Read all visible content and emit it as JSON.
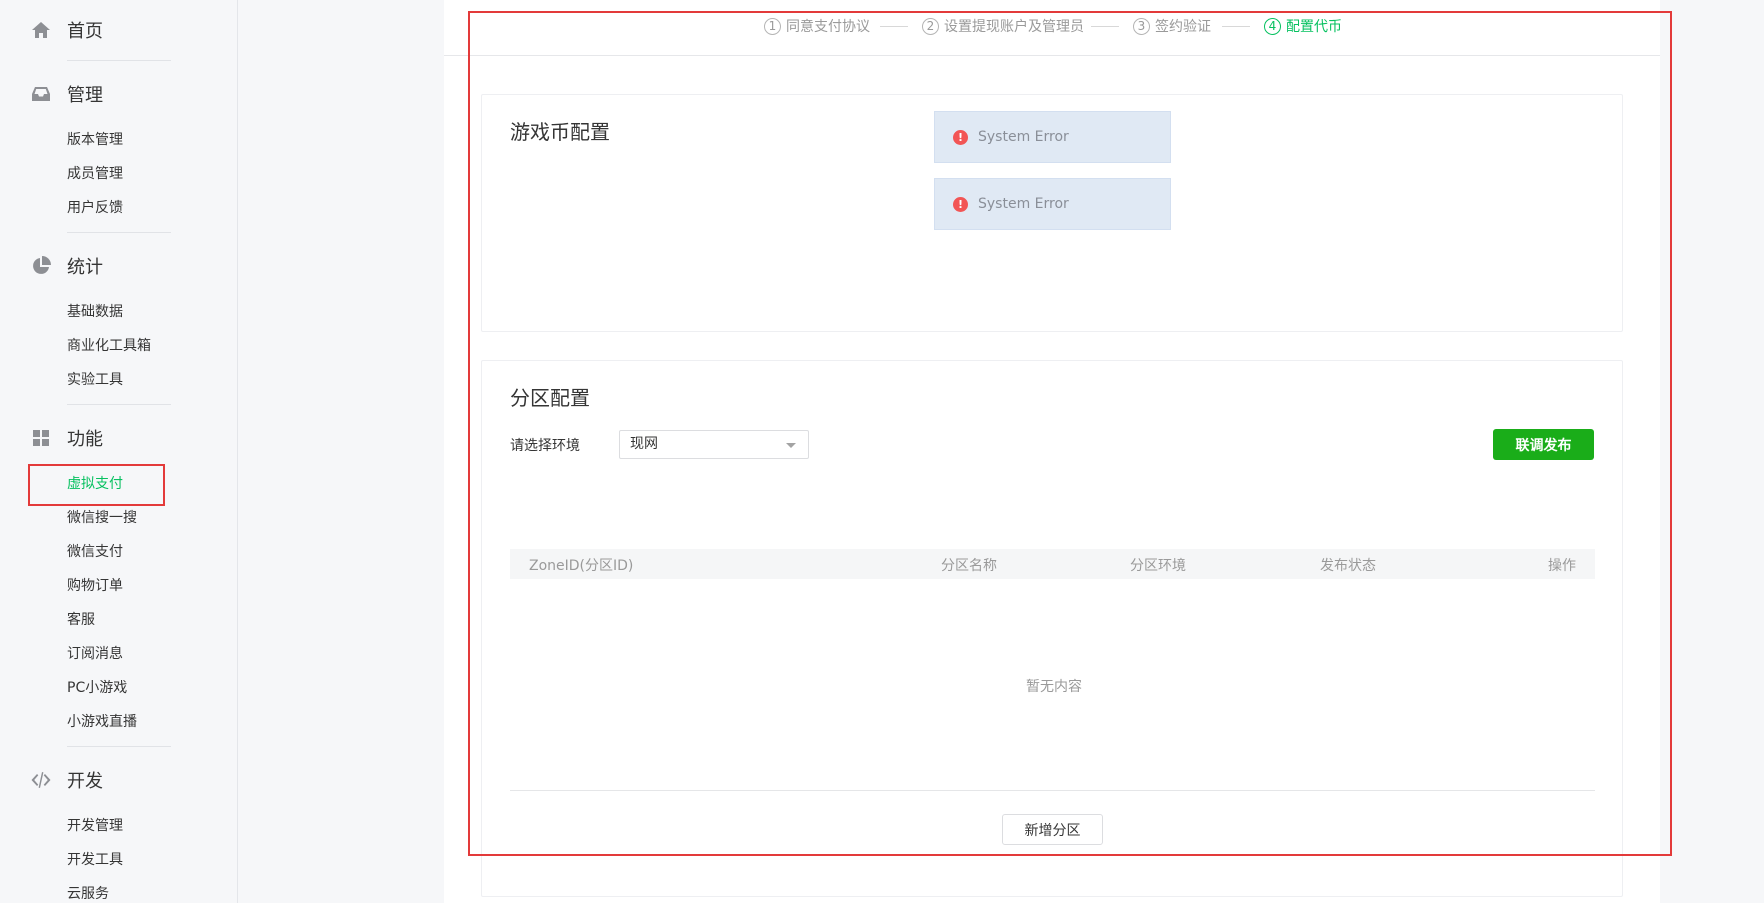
{
  "sidebar": {
    "home": {
      "label": "首页",
      "icon": "home-icon"
    },
    "manage": {
      "label": "管理",
      "icon": "inbox-icon",
      "items": [
        "版本管理",
        "成员管理",
        "用户反馈"
      ]
    },
    "stats": {
      "label": "统计",
      "icon": "pie-chart-icon",
      "items": [
        "基础数据",
        "商业化工具箱",
        "实验工具"
      ]
    },
    "features": {
      "label": "功能",
      "icon": "grid-icon",
      "items": [
        "虚拟支付",
        "微信搜一搜",
        "微信支付",
        "购物订单",
        "客服",
        "订阅消息",
        "PC小游戏",
        "小游戏直播"
      ],
      "active_index": 0
    },
    "dev": {
      "label": "开发",
      "icon": "code-icon",
      "items": [
        "开发管理",
        "开发工具",
        "云服务"
      ]
    }
  },
  "steps": [
    {
      "num": "1",
      "label": "同意支付协议"
    },
    {
      "num": "2",
      "label": "设置提现账户及管理员"
    },
    {
      "num": "3",
      "label": "签约验证"
    },
    {
      "num": "4",
      "label": "配置代币",
      "active": true
    }
  ],
  "coin_config": {
    "title": "游戏币配置",
    "errors": [
      "System Error",
      "System Error"
    ]
  },
  "zone_config": {
    "title": "分区配置",
    "env_label": "请选择环境",
    "env_value": "现网",
    "publish_button": "联调发布",
    "columns": [
      "ZoneID(分区ID)",
      "分区名称",
      "分区环境",
      "发布状态",
      "操作"
    ],
    "empty_text": "暂无内容",
    "add_button": "新增分区"
  },
  "colors": {
    "accent": "#07c160",
    "primary_button": "#1aad19",
    "highlight": "#e33a3a"
  }
}
